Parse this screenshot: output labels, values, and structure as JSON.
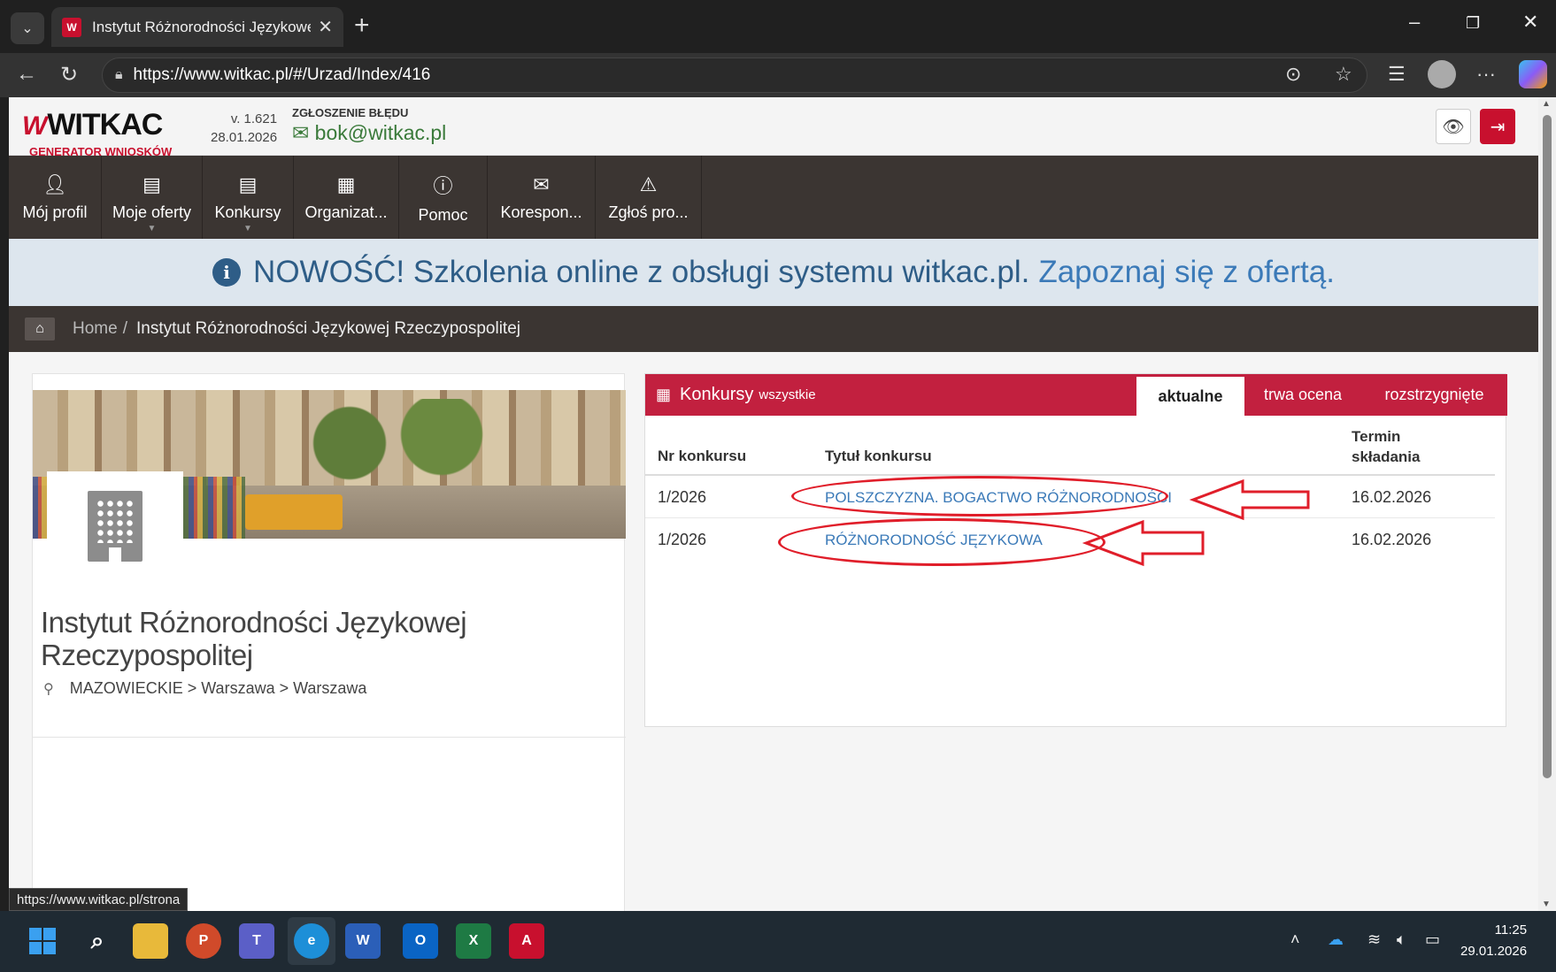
{
  "browser": {
    "tab_title": "Instytut Różnorodności Językowej",
    "url": "https://www.witkac.pl/#/Urzad/Index/416",
    "status_url": "https://www.witkac.pl/strona"
  },
  "header": {
    "logo_text": "WITKAC",
    "logo_sub": "GENERATOR WNIOSKÓW",
    "version": "v. 1.621",
    "version_date": "28.01.2026",
    "report_label": "ZGŁOSZENIE BŁĘDU",
    "email": "bok@witkac.pl"
  },
  "nav": {
    "items": [
      {
        "label": "Mój profil",
        "icon": "user-icon"
      },
      {
        "label": "Moje oferty",
        "icon": "book-icon"
      },
      {
        "label": "Konkursy",
        "icon": "book-icon"
      },
      {
        "label": "Organizat...",
        "icon": "building-icon"
      },
      {
        "label": "Pomoc",
        "icon": "info-icon"
      },
      {
        "label": "Korespon...",
        "icon": "envelope-icon"
      },
      {
        "label": "Zgłoś pro...",
        "icon": "warning-icon"
      }
    ]
  },
  "banner": {
    "text": "NOWOŚĆ! Szkolenia online z obsługi systemu witkac.pl.",
    "link": "Zapoznaj się z ofertą."
  },
  "breadcrumb": {
    "home": "Home",
    "current": "Instytut Różnorodności Językowej Rzeczypospolitej"
  },
  "profile": {
    "name": "Instytut Różnorodności Językowej Rzeczypospolitej",
    "location": "MAZOWIECKIE > Warszawa > Warszawa"
  },
  "contests": {
    "title": "Konkursy",
    "subtitle": "wszystkie",
    "tabs": [
      "aktualne",
      "trwa ocena",
      "rozstrzygnięte"
    ],
    "columns": [
      "Nr konkursu",
      "Tytuł konkursu",
      "Termin składania"
    ],
    "rows": [
      {
        "nr": "1/2026",
        "title": "POLSZCZYZNA. BOGACTWO RÓŻNORODNOŚCI",
        "deadline": "16.02.2026"
      },
      {
        "nr": "1/2026",
        "title": "RÓŻNORODNOŚĆ JĘZYKOWA",
        "deadline": "16.02.2026"
      }
    ]
  },
  "taskbar": {
    "time": "11:25",
    "date": "29.01.2026"
  },
  "colors": {
    "brand_red": "#c2203f",
    "nav_dark": "#3b3532",
    "link_blue": "#3b7ab8",
    "annotation_red": "#e01e2a"
  }
}
